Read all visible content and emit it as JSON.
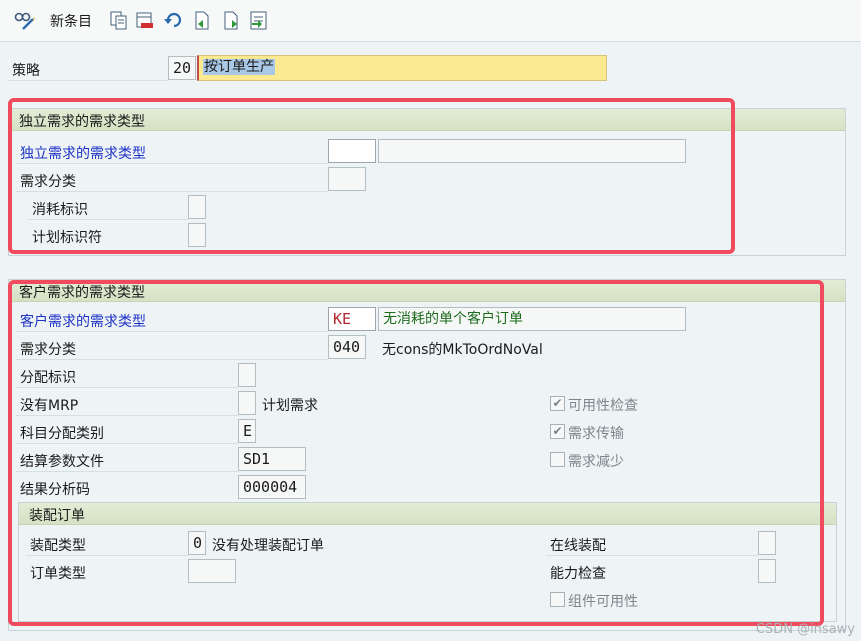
{
  "toolbar": {
    "new_entries_label": "新条目",
    "icons": [
      "glasses-pen-icon",
      "copy-icon",
      "delete-icon",
      "undo-icon",
      "prev-icon",
      "next-icon",
      "select-icon"
    ]
  },
  "strategy": {
    "label": "策略",
    "code": "20",
    "description": "按订单生产"
  },
  "independent": {
    "header": "独立需求的需求类型",
    "type_label": "独立需求的需求类型",
    "type_value": "",
    "type_desc": "",
    "class_label": "需求分类",
    "class_value": "",
    "consumption_label": "消耗标识",
    "consumption_value": "",
    "planning_label": "计划标识符",
    "planning_value": ""
  },
  "customer": {
    "header": "客户需求的需求类型",
    "type_label": "客户需求的需求类型",
    "type_value": "KE",
    "type_desc": "无消耗的单个客户订单",
    "class_label": "需求分类",
    "class_value": "040",
    "class_desc": "无cons的MkToOrdNoVal",
    "alloc_label": "分配标识",
    "alloc_value": "",
    "nomrp_label": "没有MRP",
    "nomrp_value": "",
    "nomrp_desc": "计划需求",
    "acct_label": "科目分配类别",
    "acct_value": "E",
    "settle_label": "结算参数文件",
    "settle_value": "SD1",
    "result_label": "结果分析码",
    "result_value": "000004",
    "checks": {
      "availability": "可用性检查",
      "transfer": "需求传输",
      "reduction": "需求减少"
    }
  },
  "assembly": {
    "header": "装配订单",
    "type_label": "装配类型",
    "type_value": "0",
    "type_desc": "没有处理装配订单",
    "order_type_label": "订单类型",
    "order_type_value": "",
    "online_label": "在线装配",
    "capacity_label": "能力检查",
    "component_label": "组件可用性"
  },
  "watermark": "CSDN @insawy",
  "colors": {
    "highlight": "#fbe98f",
    "red_box": "#ef4a5d",
    "link_blue": "#1d33c6",
    "desc_green": "#1c6b1c"
  }
}
